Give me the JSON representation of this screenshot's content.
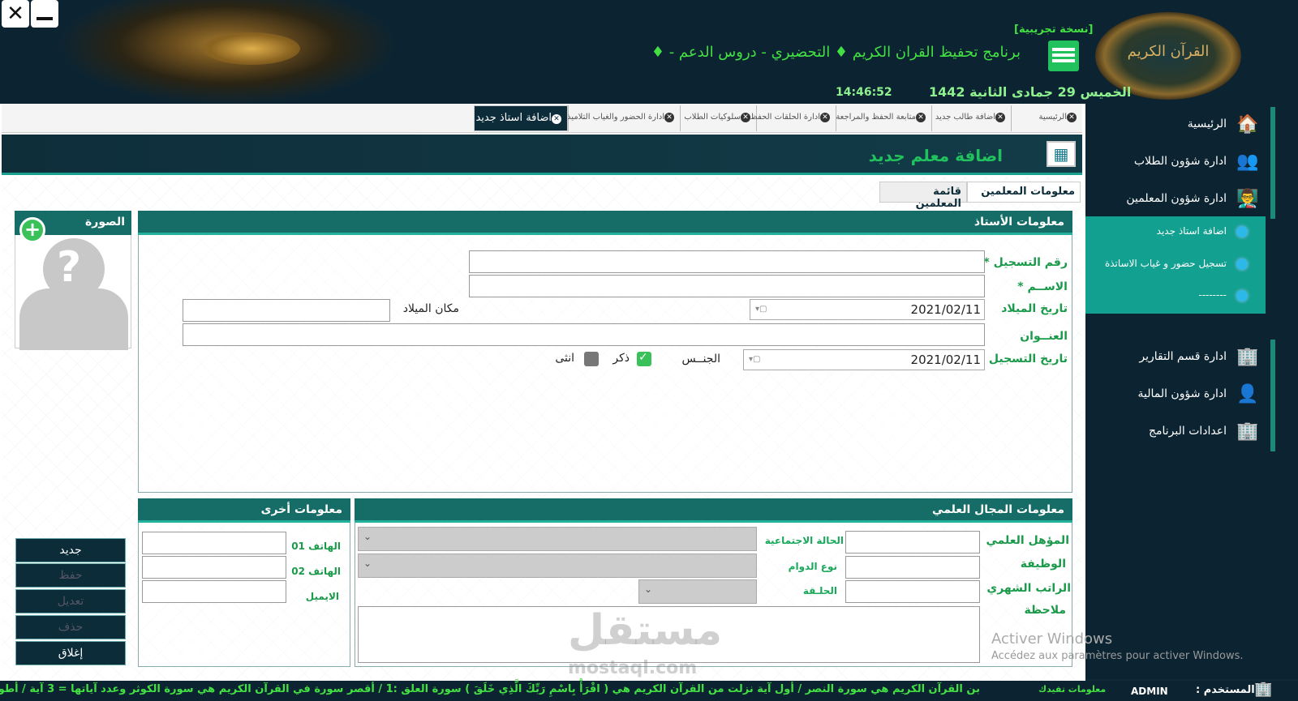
{
  "window": {
    "close_glyph": "✕"
  },
  "header": {
    "trial_label": "[نسخة تجريبية]",
    "program_title": "برنامج تحفيظ القران الكريم ♦ التحضيري - دروس الدعم - ♦",
    "date_text": "الخميس 29 جمادى الثانية 1442",
    "time_text": "14:46:52",
    "logo_text": "القرآن الكريم"
  },
  "tabs": [
    {
      "label": "الرئيسية"
    },
    {
      "label": "اضافة طالب جديد"
    },
    {
      "label": "متابعة الحفظ والمراجعة"
    },
    {
      "label": "ادارة الحلقات الحفظ"
    },
    {
      "label": "سلوكيات الطلاب"
    },
    {
      "label": "ادارة الحضور والغياب التلاميذ"
    },
    {
      "label": "اضافة استاذ جديد"
    }
  ],
  "page": {
    "title": "اضافة معلم جديد"
  },
  "inner_tabs": {
    "info": "معلومات المعلمين",
    "list": "قائمة المعلمين"
  },
  "sidebar": {
    "items": [
      {
        "label": "الرئيسية",
        "icon": "home-icon"
      },
      {
        "label": "ادارة شؤون الطلاب",
        "icon": "students-icon"
      },
      {
        "label": "ادارة شؤون المعلمين",
        "icon": "teachers-icon"
      },
      {
        "label": "ادارة قسم التقارير",
        "icon": "reports-icon"
      },
      {
        "label": "ادارة شؤون المالية",
        "icon": "finance-icon"
      },
      {
        "label": "اعدادات البرنامج",
        "icon": "settings-icon"
      }
    ],
    "sub_items": [
      {
        "label": "اضافة استاذ جديد"
      },
      {
        "label": "تسجيل حضور و غياب الاساتذة"
      },
      {
        "label": "--------"
      }
    ]
  },
  "teacher_info": {
    "heading": "معلومات الأستاذ",
    "reg_number_label": "رقم التسجيل *",
    "name_label": "الاســم *",
    "birth_date_label": "تاريخ الميلاد",
    "birth_date_value": "2021/02/11",
    "birth_place_label": "مكان الميلاد",
    "address_label": "العنــوان",
    "reg_date_label": "تاريخ التسجيل",
    "reg_date_value": "2021/02/11",
    "gender_label": "الجنــس",
    "male_label": "ذكر",
    "female_label": "انثى"
  },
  "photo": {
    "heading": "الصورة"
  },
  "other_info": {
    "heading": "معلومات أخرى",
    "phone1_label": "الهاتف 01",
    "phone2_label": "الهاتف 02",
    "email_label": "الايميل"
  },
  "academic": {
    "heading": "معلومات المجال العلمي",
    "qualification_label": "المؤهل العلمي",
    "job_label": "الوظيفة",
    "salary_label": "الراتب الشهري",
    "note_label": "ملاحظة",
    "marital_label": "الحالة الاجتماعية",
    "shift_label": "نوع الدوام",
    "halaqa_label": "الحلـقة"
  },
  "actions": {
    "new": "جديد",
    "save": "حفظ",
    "edit": "تعديل",
    "delete": "حذف",
    "close": "إغلاق"
  },
  "status": {
    "info_label": "معلومات تفيدك",
    "ticker": "بن القرآن الكريم هي سورة النصر / أول آية نزلت من القرآن الكريم هي ( اقْرَأْ بِاسْمِ رَبِّكَ الَّذِي خَلَقَ ) سورة العلق :1 / أقصر سورة في القرآن الكريم هي سورة الكوثر وعدد آياتها = 3 آية / أطول آ",
    "user_label": "المستخدم :",
    "user_value": "ADMIN"
  },
  "overlay": {
    "activate_title": "Activer Windows",
    "activate_sub": "Accédez aux paramètres pour activer Windows.",
    "watermark": "مستقل",
    "watermark_domain": "mostaql.com"
  },
  "colors": {
    "accent": "#21c15e",
    "panel_header": "#166c66",
    "dark_bg": "#0c2432",
    "submenu": "#12a090"
  }
}
